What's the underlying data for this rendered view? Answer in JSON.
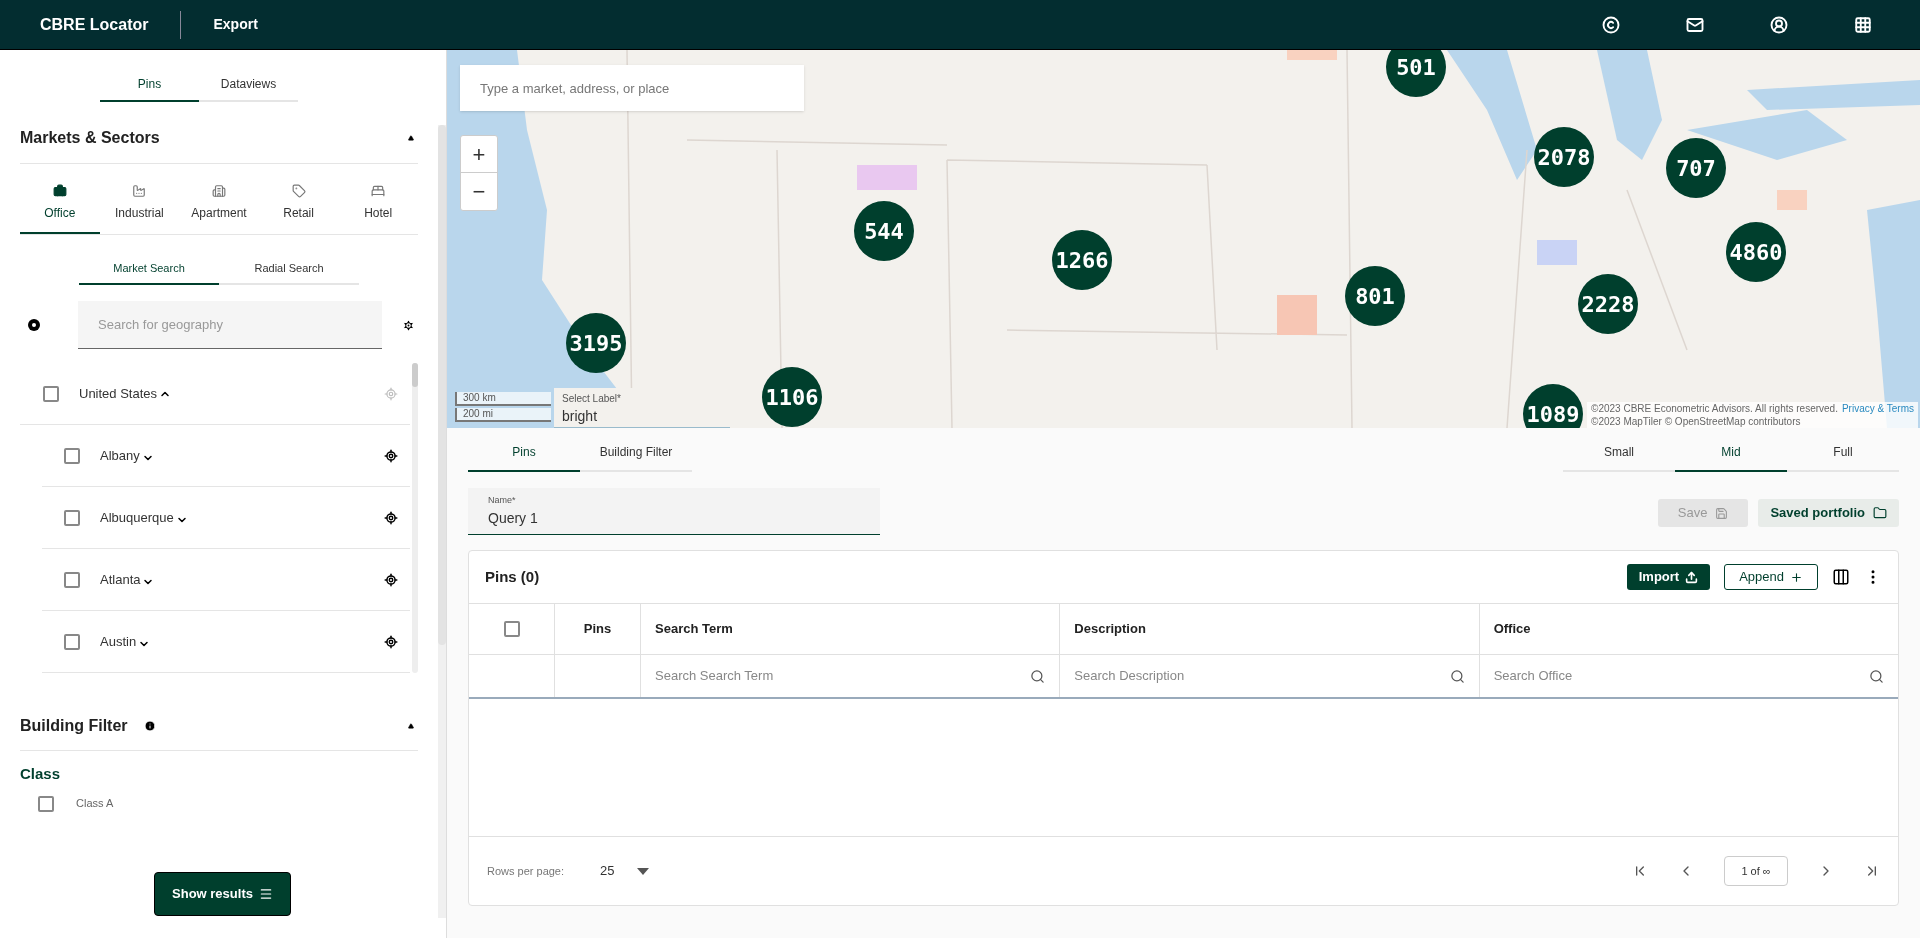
{
  "header": {
    "title": "CBRE Locator",
    "nav": [
      {
        "label": "Export"
      }
    ]
  },
  "sidebar": {
    "tabs": [
      {
        "label": "Pins",
        "selected": true
      },
      {
        "label": "Dataviews",
        "selected": false
      }
    ],
    "markets": {
      "title": "Markets & Sectors",
      "expanded": true,
      "sectors": [
        {
          "label": "Office",
          "selected": true
        },
        {
          "label": "Industrial",
          "selected": false
        },
        {
          "label": "Apartment",
          "selected": false
        },
        {
          "label": "Retail",
          "selected": false
        },
        {
          "label": "Hotel",
          "selected": false
        }
      ],
      "search_tabs": [
        {
          "label": "Market Search",
          "selected": true
        },
        {
          "label": "Radial Search",
          "selected": false
        }
      ],
      "search": {
        "placeholder": "Search for geography"
      },
      "tree": [
        {
          "label": "United States",
          "checked": false,
          "expanded": true,
          "children": [
            {
              "label": "Albany",
              "checked": false,
              "expanded": false
            },
            {
              "label": "Albuquerque",
              "checked": false,
              "expanded": false
            },
            {
              "label": "Atlanta",
              "checked": false,
              "expanded": false
            },
            {
              "label": "Austin",
              "checked": false,
              "expanded": false
            }
          ]
        }
      ]
    },
    "building_filter": {
      "title": "Building Filter",
      "expanded": true,
      "group": "Class",
      "options": [
        {
          "label": "Class A",
          "checked": false
        }
      ]
    },
    "show_results": "Show results"
  },
  "map": {
    "search": {
      "placeholder": "Type a market, address, or place"
    },
    "zoom": [
      "+",
      "−"
    ],
    "clusters": [
      {
        "count": "501"
      },
      {
        "count": "2078"
      },
      {
        "count": "707"
      },
      {
        "count": "544"
      },
      {
        "count": "1266"
      },
      {
        "count": "4860"
      },
      {
        "count": "801"
      },
      {
        "count": "2228"
      },
      {
        "count": "3195"
      },
      {
        "count": "1106"
      },
      {
        "count": "1089"
      }
    ],
    "scale": [
      "300 km",
      "200 mi"
    ],
    "label_select": {
      "label": "Select Label*",
      "value": "bright"
    },
    "attribution": {
      "line1": "©2023 CBRE Econometric Advisors. All rights reserved.",
      "link": "Privacy & Terms",
      "line2": "©2023 MapTiler © OpenStreetMap contributors"
    }
  },
  "panel": {
    "tabs": [
      {
        "label": "Pins",
        "selected": true
      },
      {
        "label": "Building Filter",
        "selected": false
      }
    ],
    "size_tabs": [
      {
        "label": "Small",
        "selected": false
      },
      {
        "label": "Mid",
        "selected": true
      },
      {
        "label": "Full",
        "selected": false
      }
    ],
    "name_field": {
      "label": "Name*",
      "value": "Query 1"
    },
    "save": {
      "label": "Save",
      "disabled": true
    },
    "saved_portfolio": "Saved portfolio",
    "table": {
      "title": "Pins (0)",
      "select_all": {
        "checked": false
      },
      "import": "Import",
      "append": "Append",
      "columns": [
        {
          "label": "Pins"
        },
        {
          "label": "Search Term",
          "filter_placeholder": "Search Search Term"
        },
        {
          "label": "Description",
          "filter_placeholder": "Search Description"
        },
        {
          "label": "Office",
          "filter_placeholder": "Search Office"
        }
      ],
      "rows_per_page": {
        "label": "Rows per page:",
        "value": "25"
      },
      "page": "1 of ∞"
    }
  }
}
